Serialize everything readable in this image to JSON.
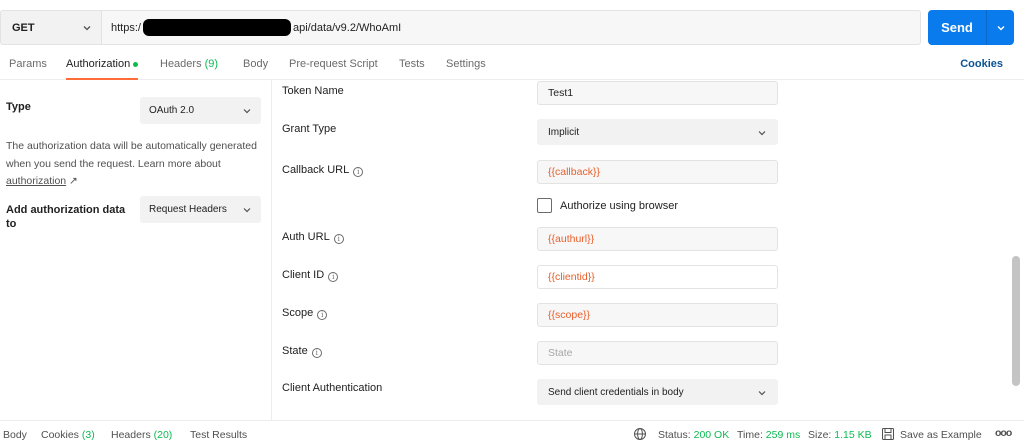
{
  "request": {
    "method": "GET",
    "url_prefix": "https:/",
    "url_suffix": "api/data/v9.2/WhoAmI",
    "send_label": "Send"
  },
  "tabs": {
    "params": "Params",
    "authorization": "Authorization",
    "headers": "Headers",
    "headers_count": "(9)",
    "body": "Body",
    "pre_request": "Pre-request Script",
    "tests": "Tests",
    "settings": "Settings",
    "cookies": "Cookies"
  },
  "auth": {
    "type_label": "Type",
    "type_value": "OAuth 2.0",
    "description": "The authorization data will be automatically generated when you send the request. Learn more about ",
    "link_text": "authorization",
    "link_arrow": "↗",
    "add_label": "Add authorization data to",
    "add_value": "Request Headers"
  },
  "form": {
    "token_name_label": "Token Name",
    "token_name_value": "Test1",
    "grant_type_label": "Grant Type",
    "grant_type_value": "Implicit",
    "callback_label": "Callback URL",
    "callback_value": "{{callback}}",
    "authorize_browser_label": "Authorize using browser",
    "auth_url_label": "Auth URL",
    "auth_url_value": "{{authurl}}",
    "client_id_label": "Client ID",
    "client_id_value": "{{clientid}}",
    "scope_label": "Scope",
    "scope_value": "{{scope}}",
    "state_label": "State",
    "state_placeholder": "State",
    "client_auth_label": "Client Authentication",
    "client_auth_value": "Send client credentials in body",
    "info_glyph": "i"
  },
  "response": {
    "body": "Body",
    "cookies": "Cookies",
    "cookies_count": "(3)",
    "headers": "Headers",
    "headers_count": "(20)",
    "test_results": "Test Results",
    "status_label": "Status:",
    "status_value": "200 OK",
    "time_label": "Time:",
    "time_value": "259 ms",
    "size_label": "Size:",
    "size_value": "1.15 KB",
    "save_example": "Save as Example",
    "more": "ooo"
  },
  "colors": {
    "accent": "#097bed",
    "active_tab": "#ff6c37",
    "variable": "#e8602c",
    "success": "#0cbb52"
  }
}
